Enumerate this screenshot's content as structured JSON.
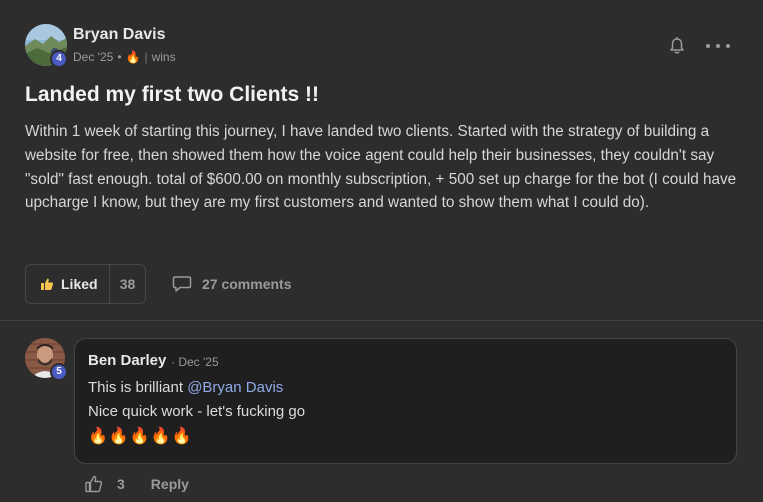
{
  "post": {
    "author": {
      "name": "Bryan Davis",
      "level": "4"
    },
    "meta": {
      "date": "Dec '25",
      "dot": "•",
      "streak_emoji": "🔥",
      "pipe": "|",
      "category": "wins"
    },
    "title": "Landed my first two Clients !!",
    "body": "Within 1 week of starting this journey, I have landed two clients. Started with the strategy of building a website for free, then showed them how the voice agent could help their businesses, they couldn't say \"sold\" fast enough. total of $600.00 on monthly subscription, + 500 set up charge for the bot (I could have upcharge I know, but they are my first customers and wanted to show them what I could do).",
    "like_button": {
      "label": "Liked",
      "count": "38"
    },
    "comments_link": {
      "label": "27 comments"
    },
    "icons": {
      "bell": "bell-icon",
      "more": "more-icon",
      "thumbs_up": "thumbs-up-icon",
      "comment": "comment-icon"
    }
  },
  "comment": {
    "author": {
      "name": "Ben Darley",
      "level": "5"
    },
    "date": "· Dec '25",
    "line1_text": "This is brilliant ",
    "mention": "@Bryan Davis",
    "line2": "Nice quick work - let's fucking go",
    "line3": "🔥🔥🔥🔥🔥",
    "like_count": "3",
    "reply_label": "Reply"
  },
  "colors": {
    "background": "#2d2d2d",
    "bubble": "#1f1f1f",
    "level_badge": "#4b5bc4",
    "mention": "#8fa9e8",
    "liked_icon": "#f5c451"
  }
}
